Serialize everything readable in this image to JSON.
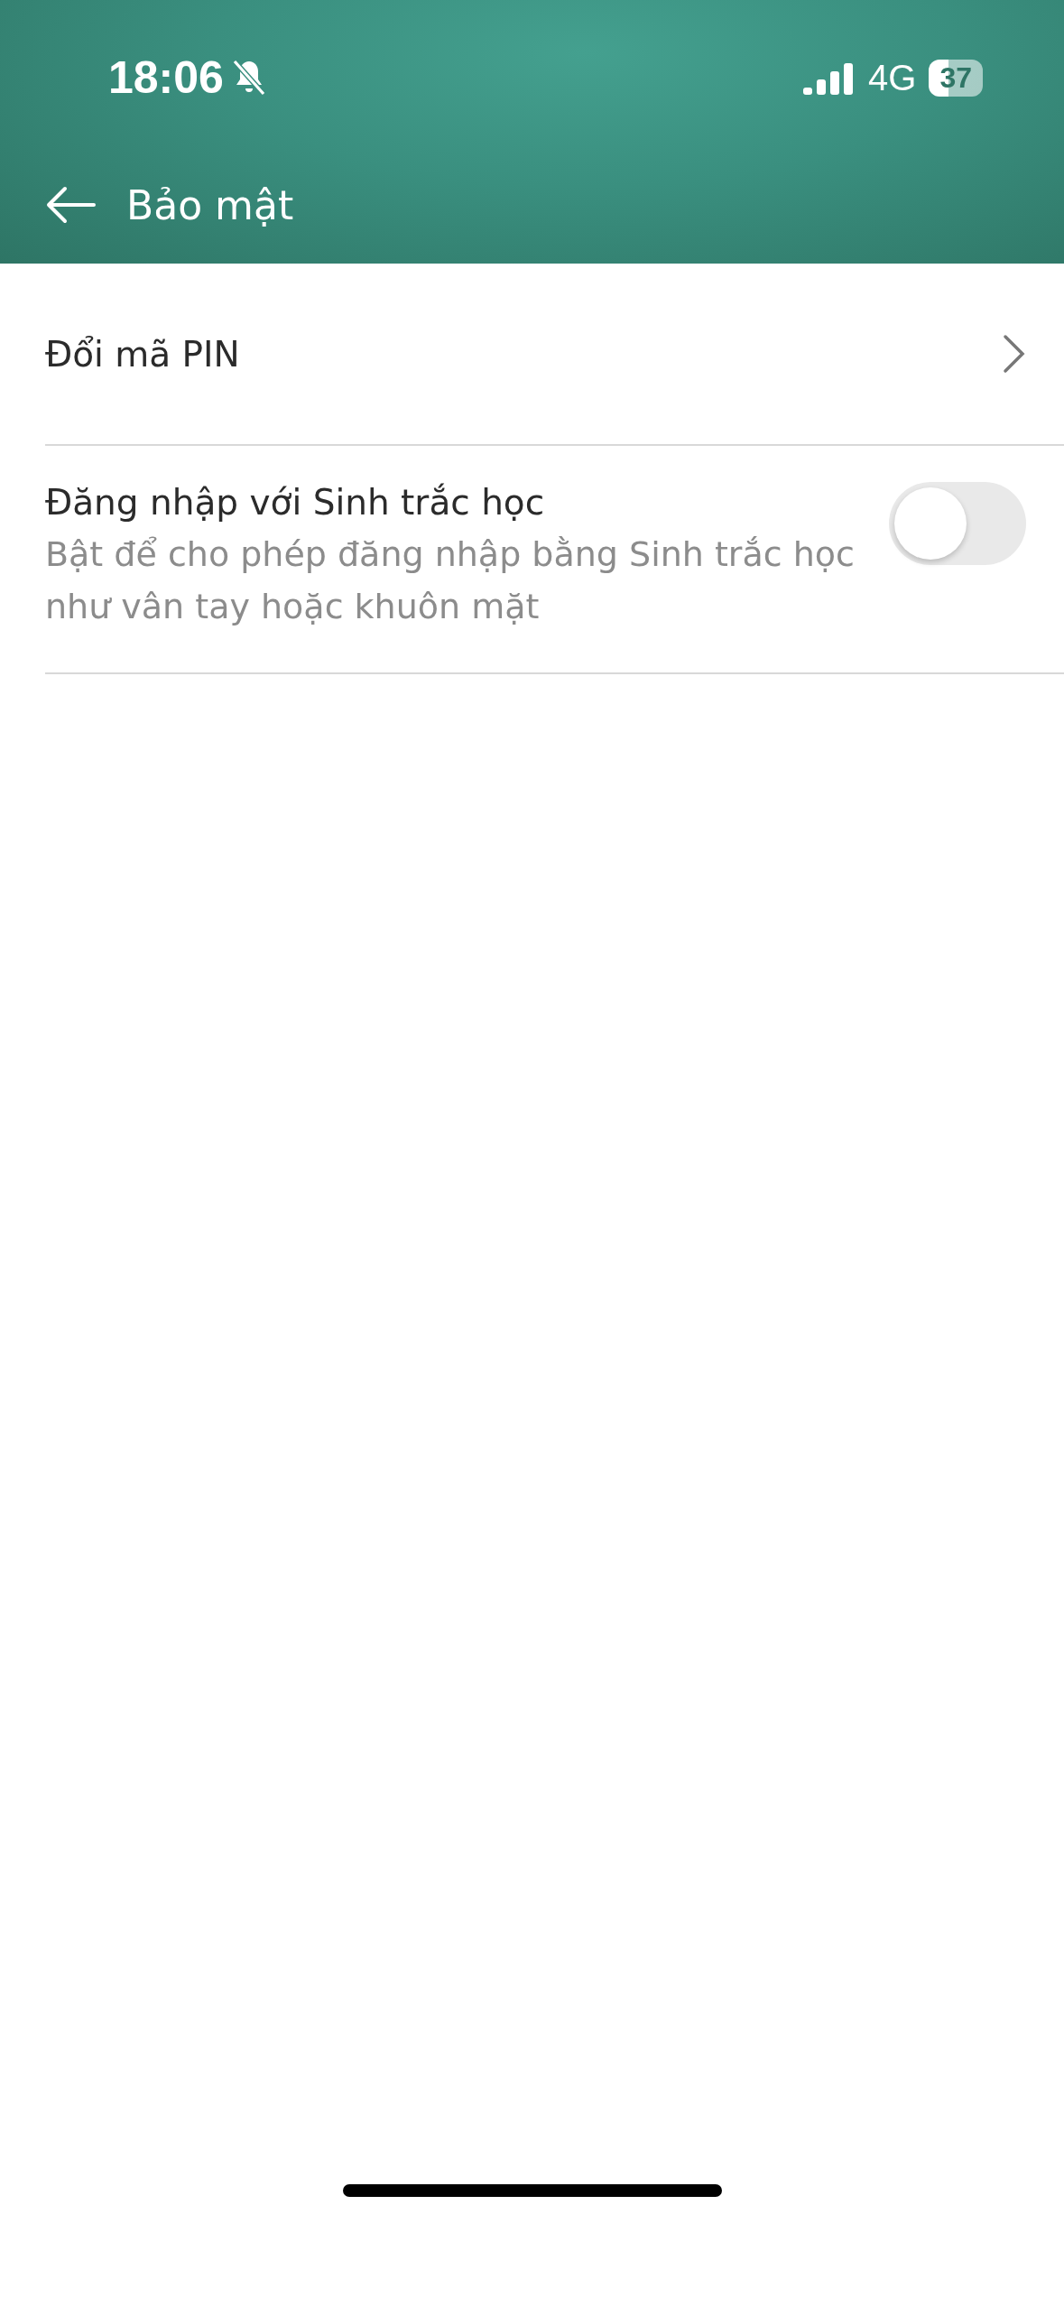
{
  "status_bar": {
    "time": "18:06",
    "silent": true,
    "network": "4G",
    "battery": "37"
  },
  "header": {
    "title": "Bảo mật"
  },
  "items": [
    {
      "kind": "link",
      "title": "Đổi mã PIN"
    },
    {
      "kind": "toggle",
      "title": "Đăng nhập với Sinh trắc học",
      "description": "Bật để cho phép đăng nhập bằng Sinh trắc học như vân tay hoặc khuôn mặt",
      "on": false
    }
  ]
}
